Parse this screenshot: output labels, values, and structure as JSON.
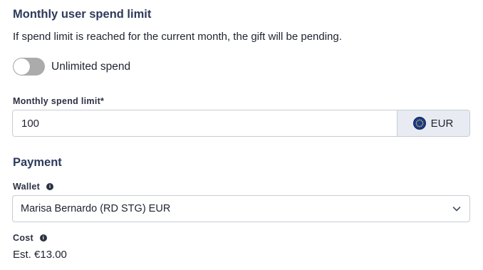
{
  "limit_section": {
    "title": "Monthly user spend limit",
    "description": "If spend limit is reached for the current month, the gift will be pending.",
    "toggle_label": "Unlimited spend",
    "toggle_on": false
  },
  "spend_field": {
    "label": "Monthly spend limit*",
    "value": "100",
    "currency": "EUR",
    "currency_icon": "eu-flag-icon"
  },
  "payment_section": {
    "title": "Payment",
    "wallet_label": "Wallet",
    "wallet_value": "Marisa Bernardo (RD STG) EUR",
    "cost_label": "Cost",
    "cost_value": "Est. €13.00"
  },
  "colors": {
    "title": "#2e3a5c",
    "toggle_off": "#ababab",
    "addon_bg": "#e8ecf2",
    "border": "#c6cbd3"
  }
}
